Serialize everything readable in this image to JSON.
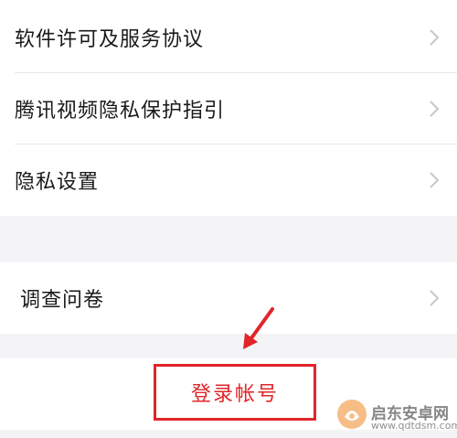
{
  "settings": {
    "items": [
      {
        "label": "软件许可及服务协议"
      },
      {
        "label": "腾讯视频隐私保护指引"
      },
      {
        "label": "隐私设置"
      }
    ],
    "survey": {
      "label": "调查问卷"
    }
  },
  "login": {
    "label": "登录帐号"
  },
  "watermark": {
    "title": "启东安卓网",
    "url": "www.qdtdsm.com"
  },
  "icons": {
    "chevron": "chevron-right-icon",
    "arrow": "arrow-down-left-icon",
    "logo": "brand-logo-icon"
  },
  "colors": {
    "accent": "#e0252a",
    "chevron": "#c7c7cc",
    "background": "#f4f4f6"
  }
}
